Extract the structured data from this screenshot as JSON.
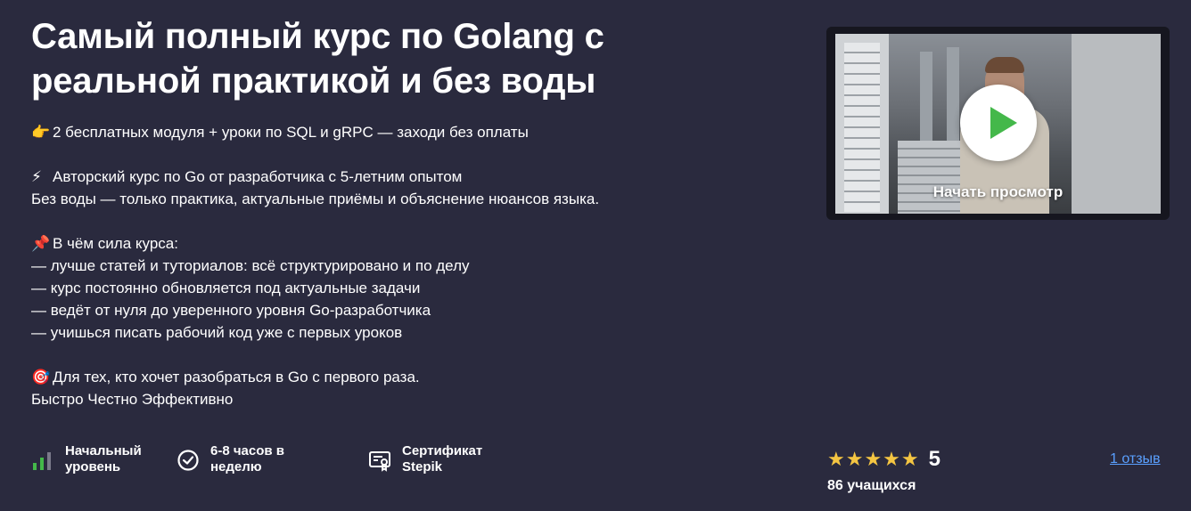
{
  "course": {
    "title": "Самый полный курс по Golang с реальной практикой и без воды"
  },
  "description": {
    "lines": [
      {
        "emoji": "👉",
        "text": "2 бесплатных модуля + уроки по SQL и gRPC — заходи без оплаты"
      },
      {
        "gap": true
      },
      {
        "emoji": "⚡",
        "text": "Авторский курс по Go от разработчика с 5-летним опытом"
      },
      {
        "text": "Без воды — только практика, актуальные приёмы и объяснение нюансов языка."
      },
      {
        "gap": true
      },
      {
        "emoji": "📌",
        "text": "В чём сила курса:"
      },
      {
        "text": "— лучше статей и туториалов: всё структурировано и по делу"
      },
      {
        "text": "— курс постоянно обновляется под актуальные задачи"
      },
      {
        "text": "— ведёт от нуля до уверенного уровня Go-разработчика"
      },
      {
        "text": "— учишься писать рабочий код уже с первых уроков"
      },
      {
        "gap": true
      },
      {
        "emoji": "🎯",
        "text": "Для тех, кто хочет разобраться в Go с первого раза."
      },
      {
        "text": "Быстро Честно Эффективно"
      }
    ]
  },
  "video": {
    "play_label": "Начать просмотр",
    "play_icon": "play-icon",
    "accent": "#44b84a"
  },
  "features": [
    {
      "icon": "level-bars-icon",
      "line1": "Начальный",
      "line2": "уровень"
    },
    {
      "icon": "clock-icon",
      "line1": "6-8 часов в",
      "line2": "неделю"
    },
    {
      "icon": "certificate-icon",
      "line1": "Сертификат",
      "line2": "Stepik"
    }
  ],
  "rating": {
    "stars": "★★★★★",
    "score": "5",
    "learners": "86 учащихся",
    "reviews_link": "1 отзыв",
    "star_color": "#f4c542",
    "link_color": "#5aa0ff"
  },
  "colors": {
    "background": "#2a2a3e",
    "level_green": "#44b84a"
  }
}
